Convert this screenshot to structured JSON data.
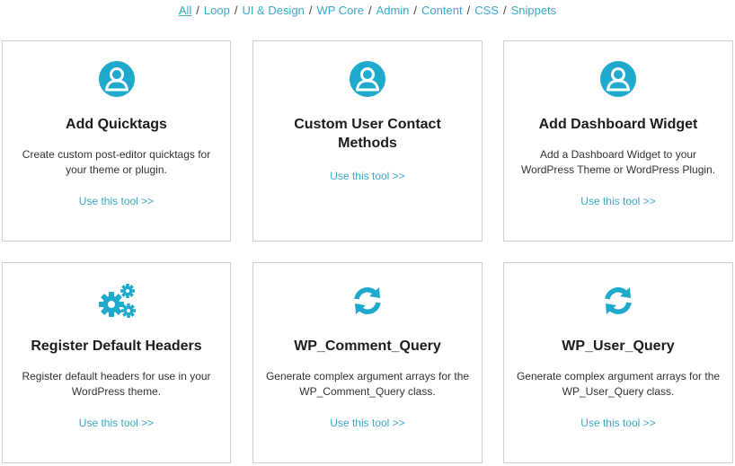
{
  "filters": [
    "All",
    "Loop",
    "UI & Design",
    "WP Core",
    "Admin",
    "Content",
    "CSS",
    "Snippets"
  ],
  "separator": "/",
  "accent_color": "#1fa9cc",
  "link_color": "#3aa8c9",
  "cards": [
    {
      "icon": "user-icon",
      "title": "Add Quicktags",
      "description": "Create custom post-editor quicktags for your theme or plugin.",
      "link": "Use this tool >>"
    },
    {
      "icon": "user-icon",
      "title": "Custom User Contact Methods",
      "description": "",
      "link": "Use this tool >>"
    },
    {
      "icon": "user-icon",
      "title": "Add Dashboard Widget",
      "description": "Add a Dashboard Widget to your WordPress Theme or WordPress Plugin.",
      "link": "Use this tool >>"
    },
    {
      "icon": "gears-icon",
      "title": "Register Default Headers",
      "description": "Register default headers for use in your WordPress theme.",
      "link": "Use this tool >>"
    },
    {
      "icon": "refresh-icon",
      "title": "WP_Comment_Query",
      "description": "Generate complex argument arrays for the WP_Comment_Query class.",
      "link": "Use this tool >>"
    },
    {
      "icon": "refresh-icon",
      "title": "WP_User_Query",
      "description": "Generate complex argument arrays for the WP_User_Query class.",
      "link": "Use this tool >>"
    }
  ]
}
